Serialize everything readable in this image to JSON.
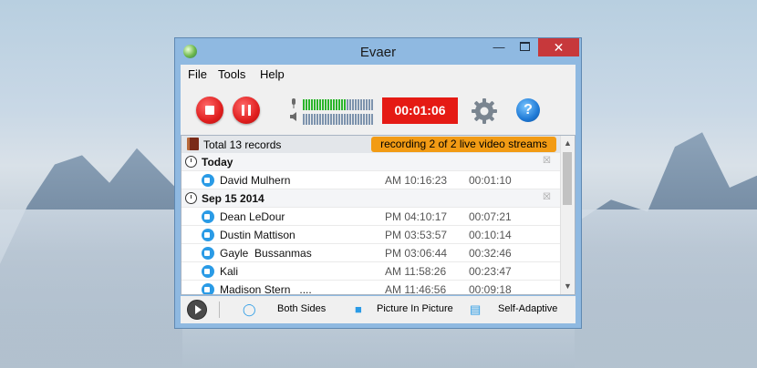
{
  "window": {
    "title": "Evaer"
  },
  "menu": [
    "File",
    "Tools",
    "Help"
  ],
  "toolbar": {
    "timer": "00:01:06"
  },
  "list": {
    "total": "Total 13 records",
    "status": "recording 2 of 2 live video streams",
    "groups": [
      {
        "label": "Today",
        "records": [
          {
            "name": "David Mulhern",
            "time": "AM 10:16:23",
            "duration": "00:01:10"
          }
        ]
      },
      {
        "label": "Sep 15 2014",
        "records": [
          {
            "name": "Dean LeDour",
            "time": "PM 04:10:17",
            "duration": "00:07:21"
          },
          {
            "name": "Dustin Mattison",
            "time": "PM 03:53:57",
            "duration": "00:10:14"
          },
          {
            "name": "Gayle  Bussanmas",
            "time": "PM 03:06:44",
            "duration": "00:32:46"
          },
          {
            "name": "Kali",
            "time": "AM 11:58:26",
            "duration": "00:23:47"
          },
          {
            "name": "Madison Stern   ....",
            "time": "AM 11:46:56",
            "duration": "00:09:18"
          }
        ]
      }
    ]
  },
  "bottom": {
    "both_sides": "Both Sides",
    "pip": "Picture In Picture",
    "self_adaptive": "Self-Adaptive"
  },
  "colors": {
    "timer_bg": "#e51a14",
    "status_badge": "#f29b14",
    "accent": "#2a9be6",
    "close": "#c7383b"
  },
  "icons": [
    "app-logo-icon",
    "stop-icon",
    "pause-icon",
    "mic-icon",
    "speaker-icon",
    "gear-icon",
    "help-icon",
    "book-icon",
    "clock-icon",
    "video-icon",
    "remove-icon",
    "play-icon",
    "headset-icon",
    "camera-icon",
    "adaptive-icon"
  ]
}
